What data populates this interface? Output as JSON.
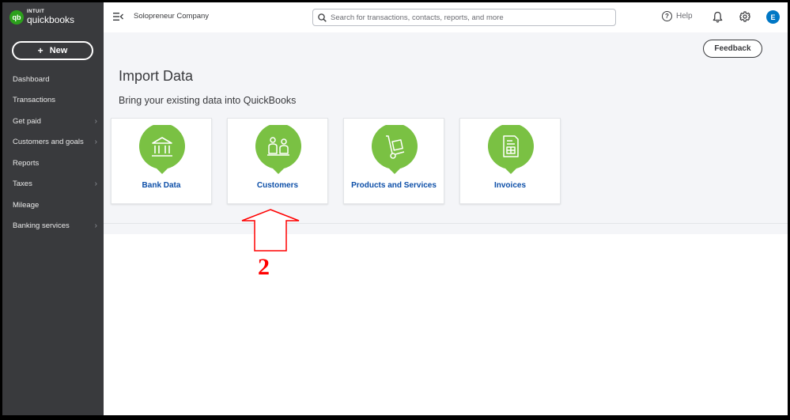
{
  "brand": {
    "badge": "qb",
    "intuit": "INTUIT",
    "product": "quickbooks",
    "color": "#2ca01c"
  },
  "sidebar": {
    "new_button": "New",
    "items": [
      {
        "label": "Dashboard",
        "chevron": false
      },
      {
        "label": "Transactions",
        "chevron": false
      },
      {
        "label": "Get paid",
        "chevron": true
      },
      {
        "label": "Customers and goals",
        "chevron": true
      },
      {
        "label": "Reports",
        "chevron": false
      },
      {
        "label": "Taxes",
        "chevron": true
      },
      {
        "label": "Mileage",
        "chevron": false
      },
      {
        "label": "Banking services",
        "chevron": true
      }
    ]
  },
  "header": {
    "company": "Solopreneur Company",
    "search_placeholder": "Search for transactions, contacts, reports, and more",
    "help": "Help",
    "avatar_initial": "E"
  },
  "main": {
    "feedback": "Feedback",
    "title": "Import Data",
    "subtitle": "Bring your existing data into QuickBooks",
    "cards": [
      {
        "label": "Bank Data",
        "icon": "bank-icon"
      },
      {
        "label": "Customers",
        "icon": "customers-icon"
      },
      {
        "label": "Products and Services",
        "icon": "hand-truck-icon"
      },
      {
        "label": "Invoices",
        "icon": "invoice-icon"
      }
    ]
  },
  "annotation": {
    "step_number": "2",
    "color": "#ff0000"
  }
}
